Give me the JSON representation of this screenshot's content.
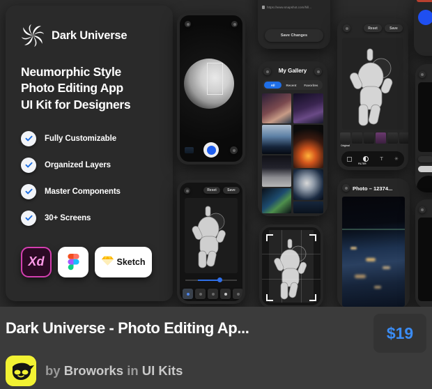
{
  "hero": {
    "brand": "Dark Universe",
    "logo_icon": "spiral-swirl-logo-icon",
    "headline": "Neumorphic Style\nPhoto Editing App\nUI Kit for Designers",
    "headline_lines": [
      "Neumorphic Style",
      "Photo Editing App",
      "UI Kit for Designers"
    ],
    "features": [
      {
        "label": "Fully Customizable",
        "icon": "check-circle-icon"
      },
      {
        "label": "Organized Layers",
        "icon": "check-circle-icon"
      },
      {
        "label": "Master Components",
        "icon": "check-circle-icon"
      },
      {
        "label": "30+ Screens",
        "icon": "check-circle-icon"
      }
    ],
    "badges": [
      {
        "id": "xd",
        "label": "Xd",
        "icon": "adobe-xd-icon"
      },
      {
        "id": "figma",
        "label": "",
        "icon": "figma-icon"
      },
      {
        "id": "sketch",
        "label": "Sketch",
        "icon": "sketch-diamond-icon"
      }
    ]
  },
  "screens": {
    "camera": {
      "name": "camera-screen",
      "flash_icon": "flash-icon",
      "settings_icon": "settings-icon",
      "shutter_icon": "shutter-button-icon",
      "thumbnail_icon": "gallery-thumbnail-icon",
      "flip_icon": "flip-camera-icon",
      "subject": "moon"
    },
    "browser": {
      "name": "browser-share-card",
      "url": "https://www.snapshot.com/hill...",
      "lock_icon": "lock-icon",
      "save_button": "Save Changes"
    },
    "gallery": {
      "name": "gallery-screen",
      "title": "My Gallery",
      "back_icon": "back-arrow-icon",
      "more_icon": "more-options-icon",
      "tabs": [
        "All",
        "Recent",
        "Favorites"
      ],
      "active_tab": "All"
    },
    "filter": {
      "name": "filter-screen",
      "back_icon": "back-arrow-icon",
      "reset_button": "Reset",
      "save_button": "Save",
      "first_filter_label": "Original",
      "toolbar_label": "FILTER",
      "tools": [
        "crop-icon",
        "filter-icon",
        "text-icon",
        "adjust-icon"
      ],
      "subject": "astronaut"
    },
    "adjust": {
      "name": "adjust-screen",
      "back_icon": "back-arrow-icon",
      "reset_button": "Reset",
      "save_button": "Save",
      "slider_value": 62,
      "tools": [
        "brightness-icon",
        "contrast-icon",
        "saturation-icon",
        "exposure-icon",
        "warmth-icon"
      ],
      "subject": "astronaut"
    },
    "crop": {
      "name": "crop-screen",
      "corner_icon": "crop-corner-icon",
      "subject": "astronaut"
    },
    "detail": {
      "name": "photo-detail-screen",
      "title": "Photo – 12374...",
      "back_icon": "back-arrow-icon",
      "subject": "earth-at-night"
    }
  },
  "meta": {
    "title": "Dark Universe - Photo Editing Ap...",
    "price": "$19",
    "avatar_icon": "ninja-avatar-icon",
    "by_word": "by",
    "author": "Broworks",
    "in_word": "in",
    "category": "UI Kits"
  },
  "colors": {
    "page_bg": "#3b3b3b",
    "preview_bg": "#2b2b2b",
    "hero_bg": "#2a2a2a",
    "accent_blue": "#3b8cf5",
    "price_badge_bg": "#333333",
    "avatar_yellow": "#f2f233",
    "text_primary": "#ffffff",
    "text_muted": "#9a9a9a"
  }
}
